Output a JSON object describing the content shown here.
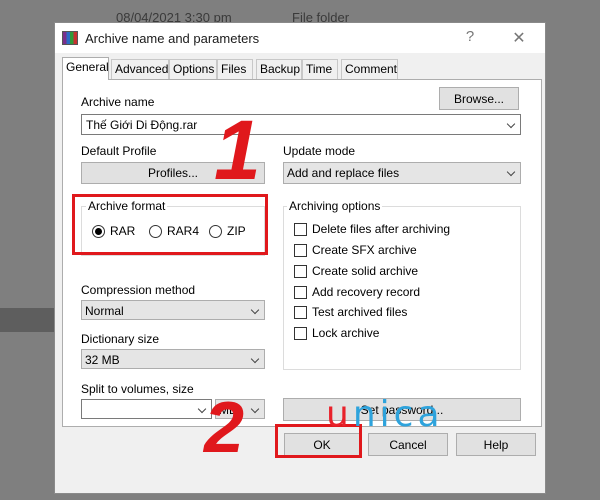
{
  "background": {
    "date": "08/04/2021 3:30 pm",
    "type": "File folder"
  },
  "window": {
    "title": "Archive name and parameters",
    "help_glyph": "?",
    "close_glyph": "✕"
  },
  "tabs": [
    "General",
    "Advanced",
    "Options",
    "Files",
    "Backup",
    "Time",
    "Comment"
  ],
  "general": {
    "archive_name_label": "Archive name",
    "browse_button": "Browse...",
    "archive_name_value": "Thế Giới Di Động.rar",
    "default_profile_label": "Default Profile",
    "profiles_button": "Profiles...",
    "update_mode_label": "Update mode",
    "update_mode_value": "Add and replace files",
    "archive_format": {
      "label": "Archive format",
      "options": [
        "RAR",
        "RAR4",
        "ZIP"
      ],
      "selected": "RAR"
    },
    "compression_method_label": "Compression method",
    "compression_method_value": "Normal",
    "dictionary_size_label": "Dictionary size",
    "dictionary_size_value": "32 MB",
    "split_label": "Split to volumes, size",
    "split_value": "",
    "split_unit": "MB",
    "archiving_options": {
      "label": "Archiving options",
      "items": [
        "Delete files after archiving",
        "Create SFX archive",
        "Create solid archive",
        "Add recovery record",
        "Test archived files",
        "Lock archive"
      ]
    },
    "set_password_button": "Set password..."
  },
  "footer": {
    "ok": "OK",
    "cancel": "Cancel",
    "help": "Help"
  },
  "annotations": {
    "step1": "1",
    "step2": "2"
  },
  "watermark": {
    "letters": [
      "u",
      "n",
      "i",
      "c",
      "a"
    ],
    "colors": {
      "u": "#e8212a",
      "n": "#2ea3dc",
      "i": "#2ea3dc",
      "c": "#2ea3dc",
      "a": "#2ea3dc"
    }
  },
  "colors": {
    "highlight": "#e0181c",
    "dialog_bg": "#f0f0f0",
    "desktop": "#7f7f7f"
  }
}
